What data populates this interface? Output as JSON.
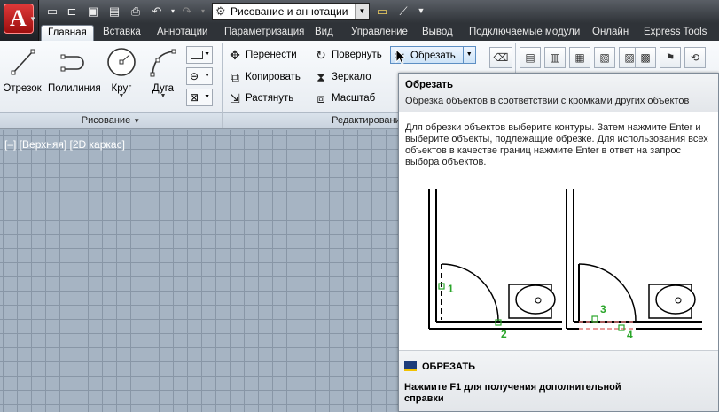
{
  "quick_access": {
    "workspace": "Рисование и аннотации",
    "icons": [
      "new-file-icon",
      "open-file-icon",
      "save-icon",
      "save-as-icon",
      "print-icon",
      "undo-icon",
      "redo-icon",
      "layer-icon",
      "match-properties-icon",
      "overflow-icon"
    ]
  },
  "tabs": [
    "Главная",
    "Вставка",
    "Аннотации",
    "Параметризация",
    "Вид",
    "Управление",
    "Вывод",
    "Подключаемые модули",
    "Онлайн",
    "Express Tools"
  ],
  "active_tab": "Главная",
  "ribbon": {
    "draw_panel": {
      "title": "Рисование",
      "tools": [
        "Отрезок",
        "Полилиния",
        "Круг",
        "Дуга"
      ]
    },
    "modify_panel": {
      "title": "Редактирование",
      "tools": [
        "Перенести",
        "Повернуть",
        "Обрезать",
        "Копировать",
        "Зеркало",
        "Растянуть",
        "Масштаб"
      ]
    }
  },
  "viewport": {
    "label": "[–] [Верхняя] [2D каркас]"
  },
  "tooltip": {
    "title": "Обрезать",
    "description": "Обрезка объектов в соответствии с кромками других объектов",
    "body": "Для обрезки объектов выберите контуры. Затем нажмите Enter и выберите объекты, подлежащие обрезке. Для использования всех объектов в качестве границ нажмите Enter в ответ на запрос выбора объектов.",
    "diagram_labels": [
      "1",
      "2",
      "3",
      "4"
    ],
    "command": "ОБРЕЗАТЬ",
    "help": "Нажмите F1 для получения дополнительной справки"
  },
  "colors": {
    "canvas": "#a6b4c3",
    "grid": "#8896a6",
    "accent_green": "#2aa52a",
    "app_button": "#c01a1a"
  }
}
